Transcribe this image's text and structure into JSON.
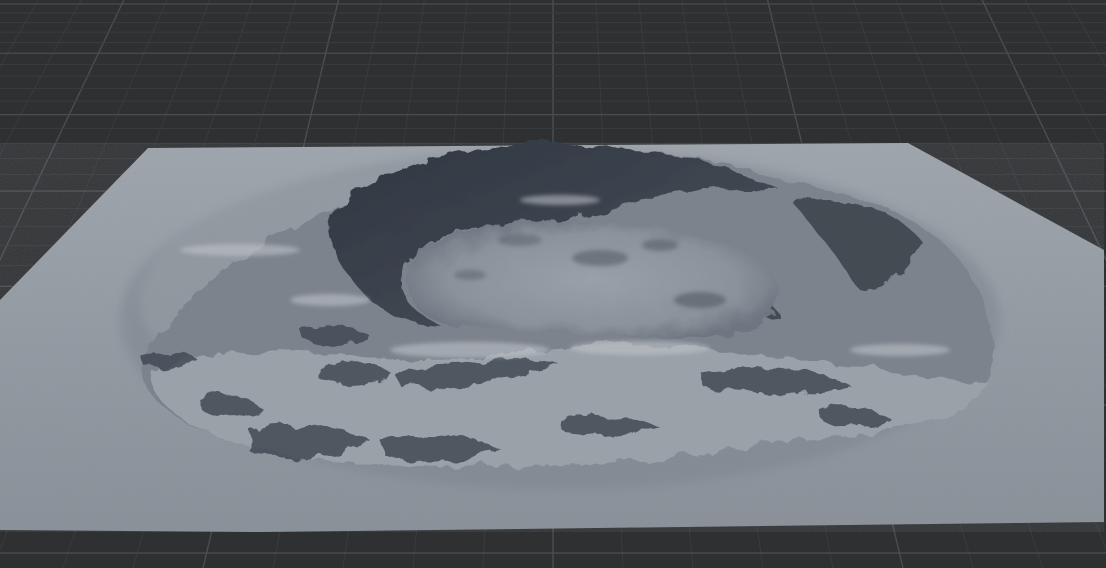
{
  "viewport": {
    "background_color": "#2e3032",
    "grid_minor_color": "#3a3c3f",
    "grid_major_color": "#4a4d51",
    "terrain_base_color": "#8f959c",
    "terrain_shadow_color": "#3b424c",
    "terrain_highlight_color": "#b4b9bf"
  },
  "objects": [
    {
      "name": "ground-grid",
      "icon": "grid-floor"
    },
    {
      "name": "terrain-mesh",
      "icon": "terrain-heightfield"
    }
  ]
}
